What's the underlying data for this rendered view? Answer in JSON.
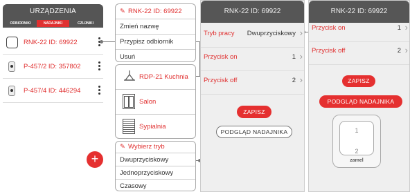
{
  "panel1": {
    "title": "URZĄDZENIA",
    "tabs": [
      "ODBIORNIKI",
      "NADAJNIKI",
      "CZUJNIKI"
    ],
    "active_tab": "NADAJNIKI",
    "devices": [
      {
        "label": "RNK-22 ID: 69922",
        "icon": "switch-icon"
      },
      {
        "label": "P-457/2 ID: 357802",
        "icon": "remote-icon"
      },
      {
        "label": "P-457/4 ID: 446294",
        "icon": "remote-icon"
      }
    ],
    "fab_label": "+"
  },
  "context_menu": {
    "title": "RNK-22 ID: 69922",
    "items": [
      "Zmień nazwę",
      "Przypisz odbiornik",
      "Usuń"
    ]
  },
  "receiver_menu": {
    "items": [
      {
        "label": "RDP-21 Kuchnia",
        "icon": "lamp-icon"
      },
      {
        "label": "Salon",
        "icon": "door-icon"
      },
      {
        "label": "Sypialnia",
        "icon": "shutter-icon"
      }
    ]
  },
  "mode_menu": {
    "title": "Wybierz tryb",
    "items": [
      "Dwuprzyciskowy",
      "Jednoprzyciskowy",
      "Czasowy"
    ]
  },
  "screen3": {
    "title": "RNK-22 ID: 69922",
    "rows": [
      {
        "label": "Tryb pracy",
        "value": "Dwuprzyciskowy"
      },
      {
        "label": "Przycisk on",
        "value": "1"
      },
      {
        "label": "Przycisk off",
        "value": "2"
      }
    ],
    "save_label": "ZAPISZ",
    "preview_label": "PODGLĄD NADAJNIKA"
  },
  "screen4": {
    "title": "RNK-22 ID: 69922",
    "rows": [
      {
        "label": "Przycisk on",
        "value": "1"
      },
      {
        "label": "Przycisk off",
        "value": "2"
      }
    ],
    "save_label": "ZAPISZ",
    "preview_label": "PODGLĄD NADAJNIKA",
    "device": {
      "btn1": "1",
      "btn2": "2",
      "brand": "zamel"
    }
  },
  "chevron": "›",
  "colors": {
    "accent": "#e03030",
    "header": "#565656"
  }
}
